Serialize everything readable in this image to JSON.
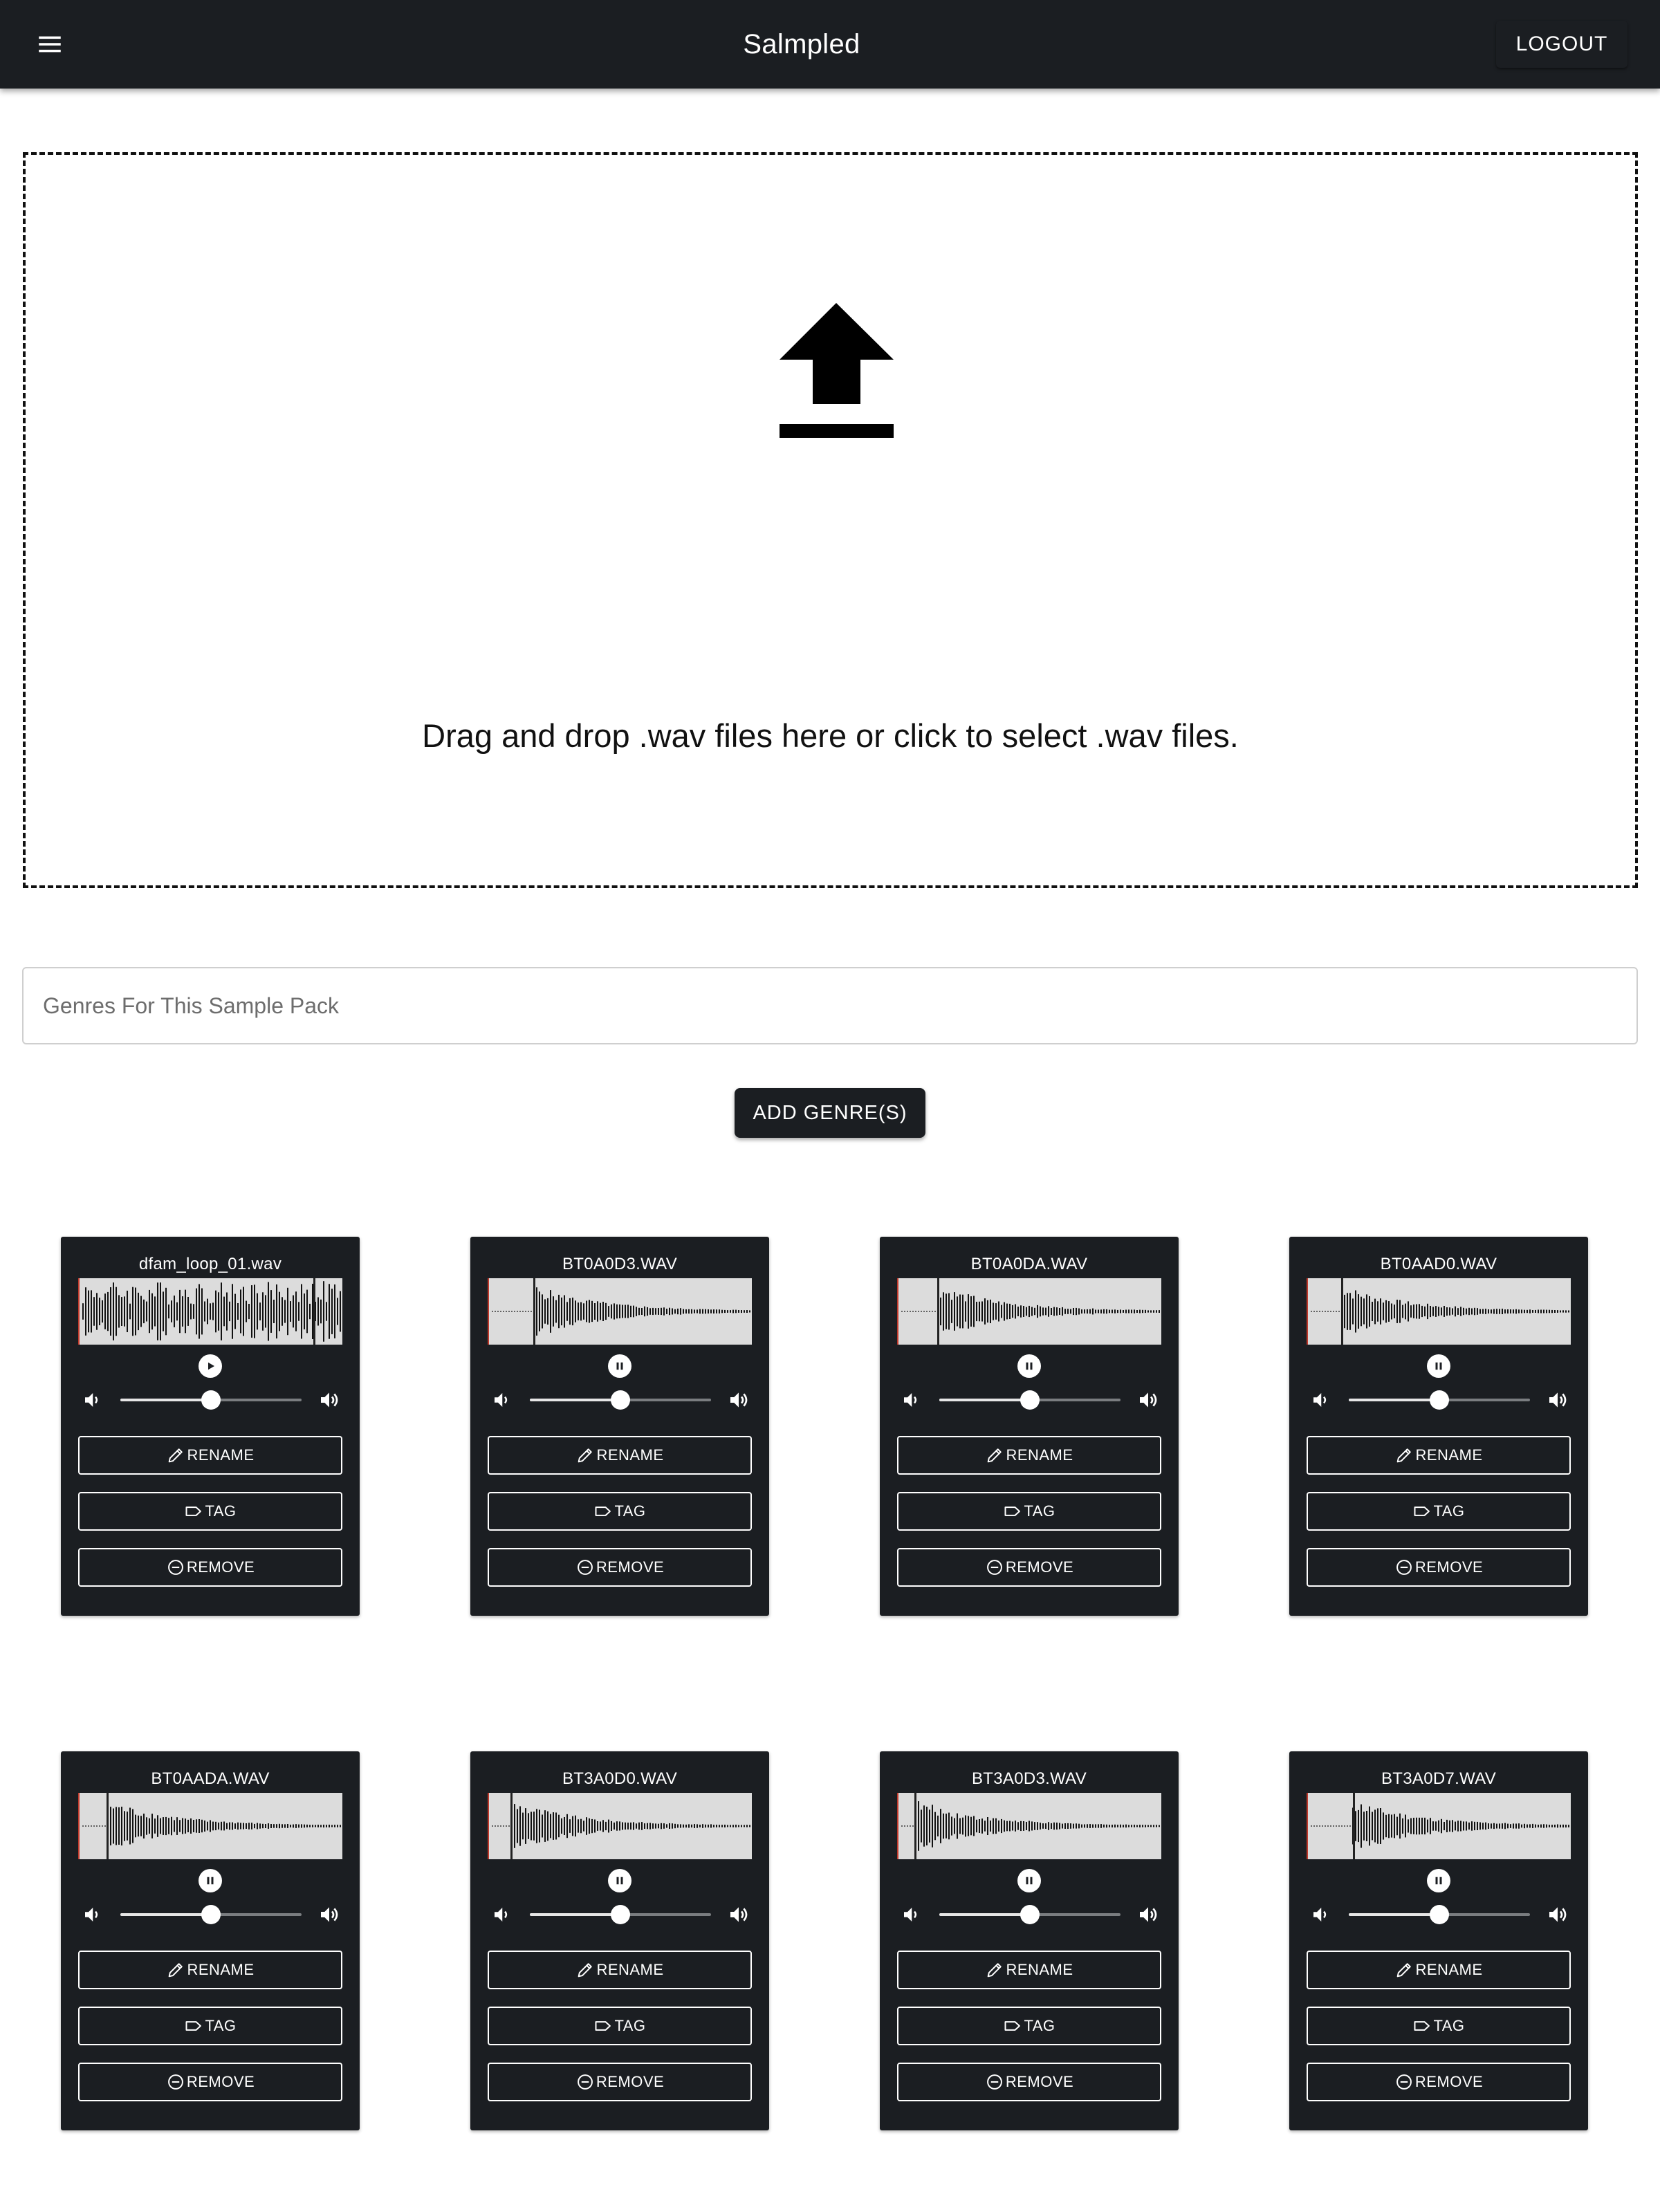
{
  "header": {
    "title": "Salmpled",
    "logout_label": "LOGOUT"
  },
  "icons": {
    "menu": "hamburger-menu-icon",
    "upload": "upload-arrow-icon",
    "play": "play-icon",
    "pause": "pause-icon",
    "volume_low": "volume-down-icon",
    "volume_high": "volume-up-icon",
    "rename": "pencil-icon",
    "tag": "tag-icon",
    "remove": "minus-circle-icon"
  },
  "colors": {
    "appbar": "#1b1e22",
    "card": "#1b1e22",
    "waveform_bg": "#dcdcdc",
    "waveform_bars": "#111111",
    "cursor_marker": "#c0392b"
  },
  "dropzone": {
    "text": "Drag and drop .wav files here or click to select .wav files."
  },
  "genre_input": {
    "placeholder": "Genres For This Sample Pack",
    "value": ""
  },
  "add_genre_label": "ADD GENRE(S)",
  "card_buttons": {
    "rename": "RENAME",
    "tag": "TAG",
    "remove": "REMOVE"
  },
  "samples": [
    {
      "name": "dfam_loop_01.wav",
      "playing": false,
      "volume": 0.5,
      "waveform": "loop"
    },
    {
      "name": "BT0A0D3.WAV",
      "playing": true,
      "volume": 0.5,
      "waveform": "decay"
    },
    {
      "name": "BT0A0DA.WAV",
      "playing": true,
      "volume": 0.5,
      "waveform": "decay"
    },
    {
      "name": "BT0AAD0.WAV",
      "playing": true,
      "volume": 0.5,
      "waveform": "decay"
    },
    {
      "name": "BT0AADA.WAV",
      "playing": true,
      "volume": 0.5,
      "waveform": "decay"
    },
    {
      "name": "BT3A0D0.WAV",
      "playing": true,
      "volume": 0.5,
      "waveform": "decay"
    },
    {
      "name": "BT3A0D3.WAV",
      "playing": true,
      "volume": 0.5,
      "waveform": "decay"
    },
    {
      "name": "BT3A0D7.WAV",
      "playing": true,
      "volume": 0.5,
      "waveform": "decay"
    }
  ]
}
